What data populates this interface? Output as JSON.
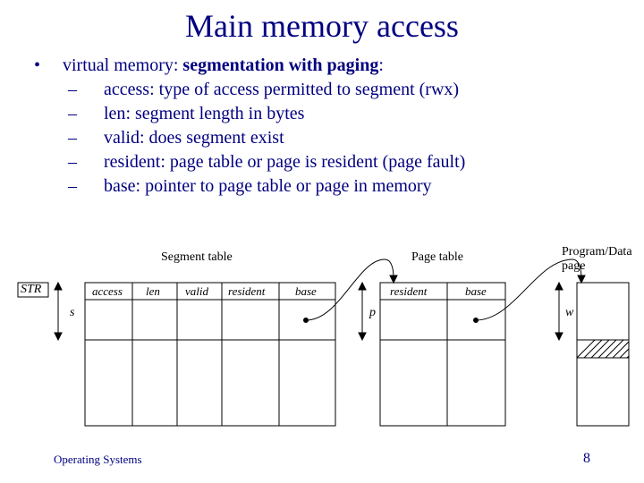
{
  "title": "Main memory access",
  "bullets": {
    "main": "virtual memory: ",
    "main_bold": "segmentation with paging",
    "main_tail": ":",
    "items": [
      {
        "term": "access",
        "desc": ": type of access permitted to segment (rwx)"
      },
      {
        "term": "len",
        "desc": ": segment length in bytes"
      },
      {
        "term": "valid",
        "desc": ": does segment exist"
      },
      {
        "term": "resident",
        "desc": ": page table or page is resident (page fault)"
      },
      {
        "term": "base",
        "desc": ": pointer to page table or page in memory"
      }
    ]
  },
  "diagram": {
    "str": "STR",
    "seg_title": "Segment table",
    "pg_title": "Page table",
    "pd_title": "Program/Data page",
    "seg_cols": {
      "c0": "access",
      "c1": "len",
      "c2": "valid",
      "c3": "resident",
      "c4": "base"
    },
    "pg_cols": {
      "c0": "resident",
      "c1": "base"
    },
    "s": "s",
    "p": "p",
    "w": "w"
  },
  "footer": {
    "left": "Operating Systems",
    "right": "8"
  }
}
